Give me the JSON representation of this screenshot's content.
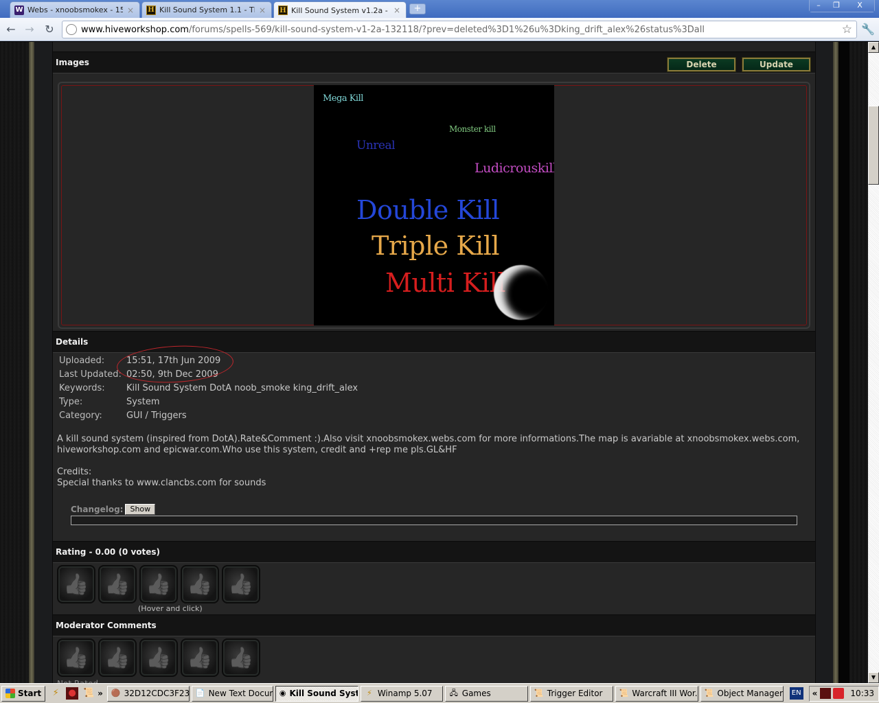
{
  "browser": {
    "tabs": [
      {
        "label": "Webs - xnoobsmokex - 15",
        "favicon": "webs-w-icon",
        "active": false
      },
      {
        "label": "Kill Sound System 1.1 - The...",
        "favicon": "hive-h-icon",
        "active": false
      },
      {
        "label": "Kill Sound System v1.2a - T...",
        "favicon": "hive-h-icon",
        "active": true
      }
    ],
    "url_host": "www.hiveworkshop.com",
    "url_path": "/forums/spells-569/kill-sound-system-v1-2a-132118/?prev=deleted%3D1%26u%3Dking_drift_alex%26status%3Dall",
    "window_buttons": {
      "minimize": "–",
      "restore": "❐",
      "close": "X"
    }
  },
  "page": {
    "images_section": {
      "title": "Images",
      "delete_label": "Delete",
      "update_label": "Update",
      "preview_texts": [
        {
          "text": "Mega Kill",
          "color": "#7fd6d6"
        },
        {
          "text": "Monster kill",
          "color": "#7fc77f"
        },
        {
          "text": "Unreal",
          "color": "#2a33b5"
        },
        {
          "text": "Ludicrouskill",
          "color": "#c44dc4"
        },
        {
          "text": "Double Kill",
          "color": "#2447d8"
        },
        {
          "text": "Triple Kill",
          "color": "#e6a84a"
        },
        {
          "text": "Multi Kill",
          "color": "#d61e1e"
        }
      ]
    },
    "details_section": {
      "title": "Details",
      "rows": [
        {
          "label": "Uploaded:",
          "value": "15:51, 17th Jun 2009"
        },
        {
          "label": "Last Updated:",
          "value": "02:50, 9th Dec 2009"
        },
        {
          "label": "Keywords:",
          "value": "Kill Sound System DotA noob_smoke king_drift_alex"
        },
        {
          "label": "Type:",
          "value": "System"
        },
        {
          "label": "Category:",
          "value": "GUI / Triggers"
        }
      ],
      "description_line1": "A kill sound system (inspired from DotA).Rate&Comment :).Also visit xnoobsmokex.webs.com for more informations.The map is avariable at xnoobsmokex.webs.com,",
      "description_line2": "hiveworkshop.com and epicwar.com.Who use this system, credit and +rep me pls.GL&HF",
      "credits_label": "Credits:",
      "credits_text": "Special thanks to www.clancbs.com for sounds",
      "changelog_label": "Changelog:",
      "changelog_button": "Show"
    },
    "rating_section": {
      "title": "Rating - 0.00 (0 votes)",
      "rating_value": 0.0,
      "votes": 0,
      "max_thumbs": 5,
      "hint": "(Hover and click)"
    },
    "moderator_section": {
      "title": "Moderator Comments",
      "max_thumbs": 5,
      "status": "Not Rated"
    }
  },
  "taskbar": {
    "start_label": "Start",
    "quicklaunch": [
      "winamp-icon",
      "app-red-icon",
      "scroll-icon"
    ],
    "overflow": "»",
    "tasks": [
      {
        "label": "32D12CDC3F235...",
        "icon": "portrait-icon",
        "active": false
      },
      {
        "label": "New Text Docum...",
        "icon": "notepad-icon",
        "active": false
      },
      {
        "label": "Kill Sound Syst...",
        "icon": "chrome-icon",
        "active": true
      },
      {
        "label": "Winamp 5.07",
        "icon": "winamp-icon",
        "active": false
      },
      {
        "label": "Games",
        "icon": "folder-network-icon",
        "active": false
      },
      {
        "label": "Trigger Editor",
        "icon": "scroll-icon",
        "active": false
      },
      {
        "label": "Warcraft III Wor...",
        "icon": "scroll-icon",
        "active": false
      },
      {
        "label": "Object Manager",
        "icon": "scroll-icon",
        "active": false
      }
    ],
    "language": "EN",
    "tray_expand": "«",
    "clock": "10:33"
  }
}
